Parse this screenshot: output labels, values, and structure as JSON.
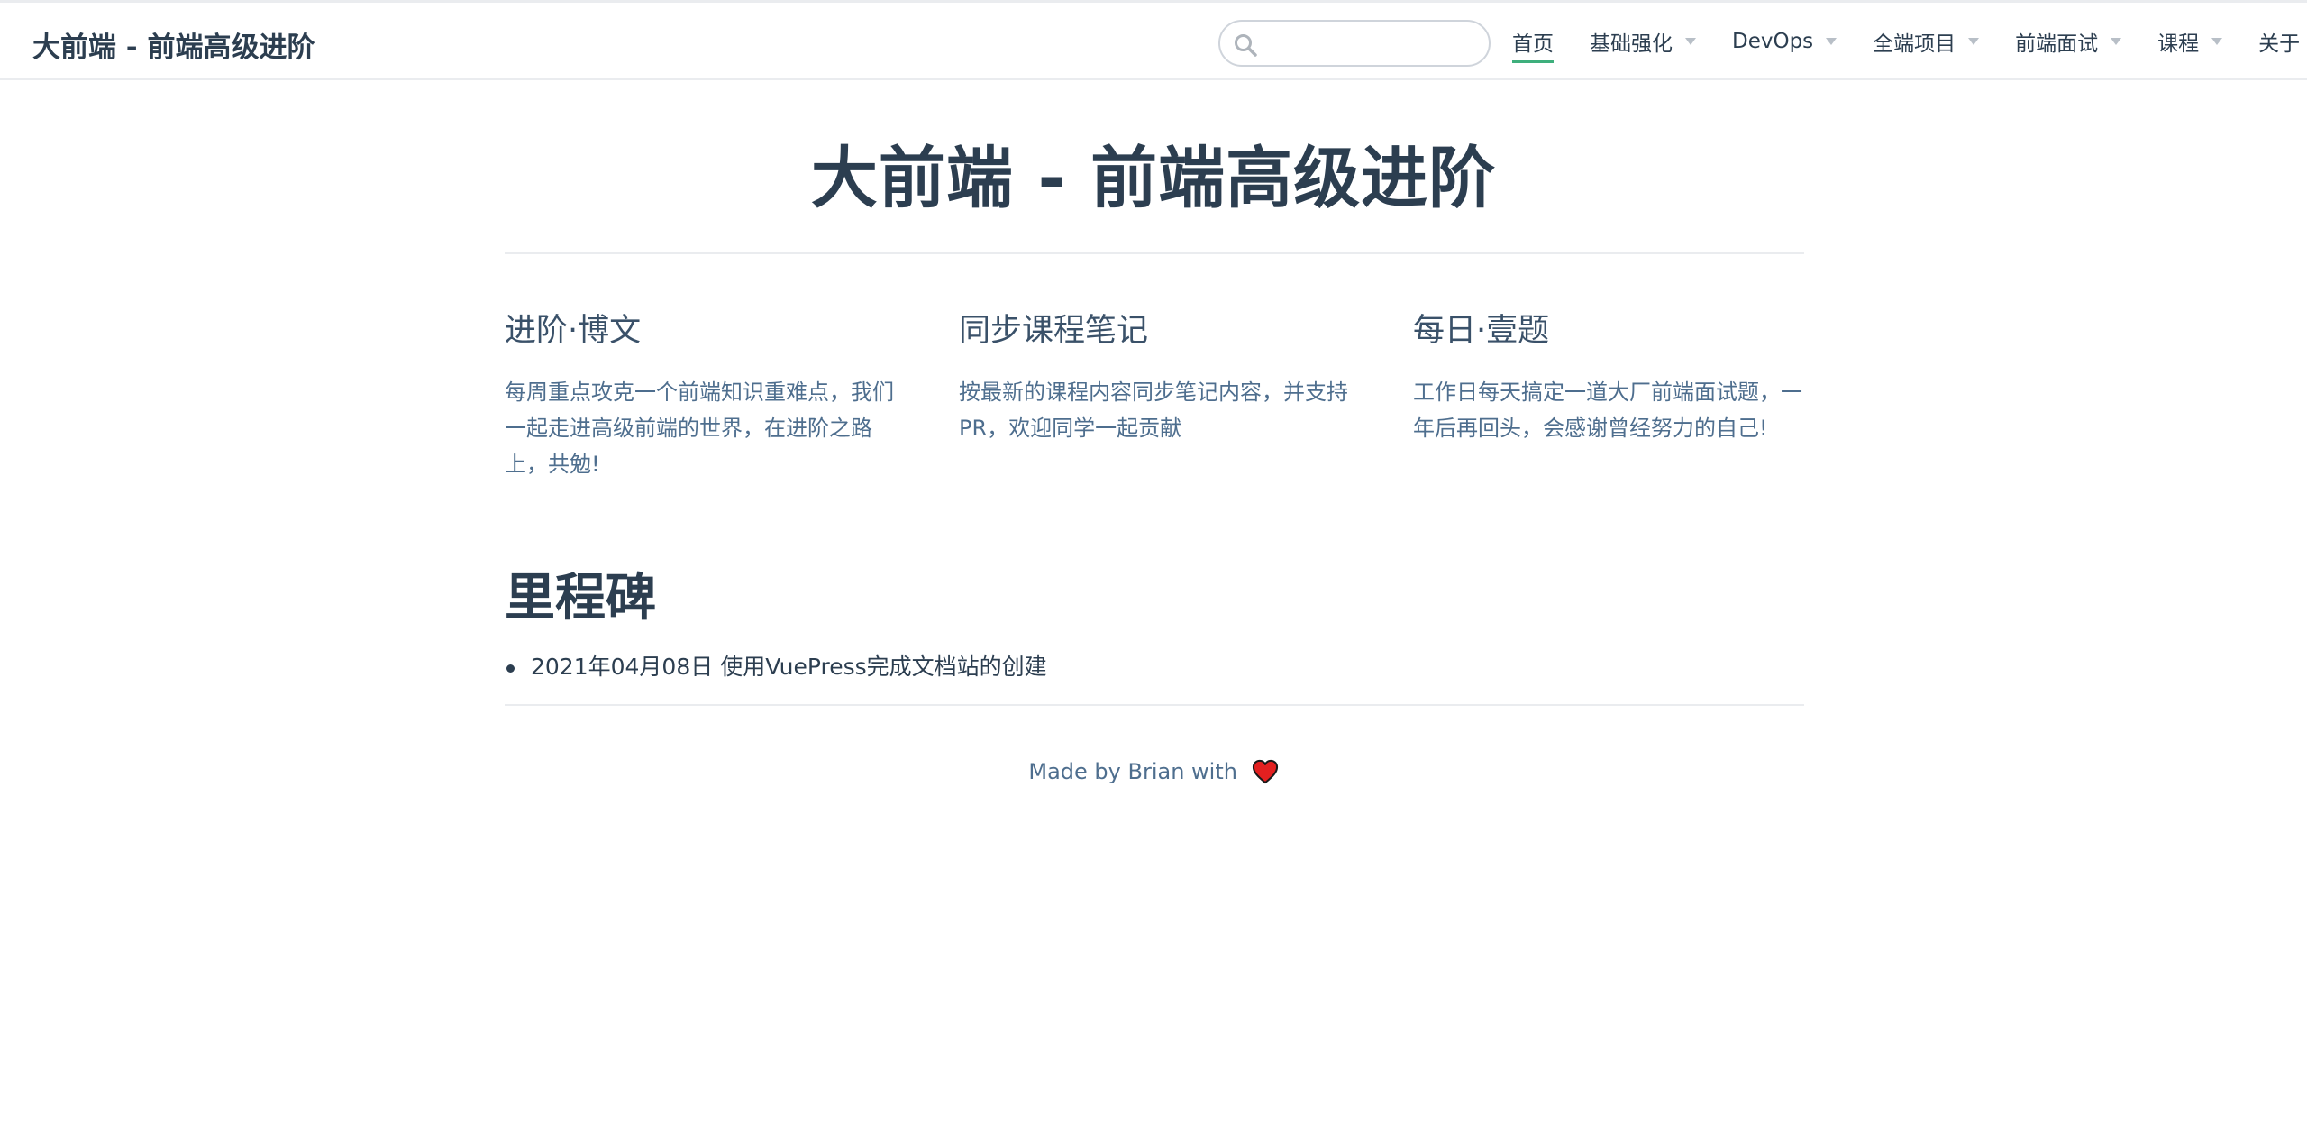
{
  "header": {
    "site_title": "大前端 - 前端高级进阶",
    "search": {
      "placeholder": "",
      "value": ""
    },
    "nav": [
      {
        "label": "首页",
        "active": true,
        "dropdown": false
      },
      {
        "label": "基础强化",
        "active": false,
        "dropdown": true
      },
      {
        "label": "DevOps",
        "active": false,
        "dropdown": true
      },
      {
        "label": "全端项目",
        "active": false,
        "dropdown": true
      },
      {
        "label": "前端面试",
        "active": false,
        "dropdown": true
      },
      {
        "label": "课程",
        "active": false,
        "dropdown": true
      },
      {
        "label": "关于",
        "active": false,
        "dropdown": true
      }
    ]
  },
  "hero": {
    "title": "大前端 - 前端高级进阶"
  },
  "features": [
    {
      "title": "进阶·博文",
      "details": "每周重点攻克一个前端知识重难点，我们一起走进高级前端的世界，在进阶之路上，共勉!"
    },
    {
      "title": "同步课程笔记",
      "details": "按最新的课程内容同步笔记内容，并支持PR，欢迎同学一起贡献"
    },
    {
      "title": "每日·壹题",
      "details": "工作日每天搞定一道大厂前端面试题，一年后再回头，会感谢曾经努力的自己!"
    }
  ],
  "milestones": {
    "title": "里程碑",
    "items": [
      "2021年04月08日 使用VuePress完成文档站的创建"
    ]
  },
  "footer": {
    "text": "Made by Brian with",
    "icon": "heart-icon"
  },
  "colors": {
    "accent": "#3eaf7c",
    "text": "#2c3e50",
    "muted_text": "#4e6e8e",
    "border": "#eaecef",
    "heart": "#e32020"
  }
}
